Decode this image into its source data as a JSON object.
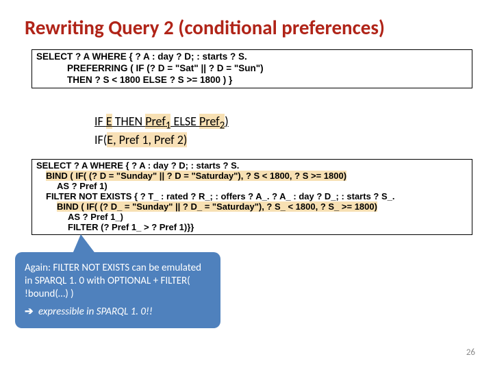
{
  "title": "Rewriting Query 2 (conditional preferences)",
  "box1": {
    "l1": "SELECT ? A WHERE { ? A : day  ? D;  : starts  ? S.",
    "l2": "            PREFERRING ( IF (? D = \"Sat\" || ? D = \"Sun\")",
    "l3": "            THEN  ? S < 1800 ELSE  ? S >= 1800 ) }"
  },
  "mid": {
    "row1_pre": "IF ",
    "row1_e": "E",
    "row1_mid": " THEN ",
    "row1_p1": "Pref",
    "row1_p1_sub": "1",
    "row1_else": " ELSE ",
    "row1_p2": "Pref",
    "row1_p2_sub": "2",
    "row1_end": ")",
    "row2_pre": "IF(",
    "row2_e": "E",
    "row2_mid": ", Pref 1",
    "row2_mid2": ", Pref 2)"
  },
  "box2": {
    "l1": "SELECT ? A WHERE { ? A : day  ? D;  : starts  ? S.",
    "l2a": "BIND ( IF( (? D = \"Sunday\" || ? D = \"Saturday\"),  ? S < 1800,  ? S >= 1800)",
    "l2b": "AS ? Pref 1)",
    "l3a": "FILTER NOT EXISTS {  ? T_ : rated  ? R_;  : offers  ? A_.  ? A_ : day  ? D_;  : starts  ? S_.",
    "l4a": "BIND ( IF( (? D_ = \"Sunday\" || ? D_ = \"Saturday\"),  ? S_ < 1800,  ? S_ >= 1800)",
    "l4b": "AS  ? Pref 1_)",
    "l4c": "FILTER (? Pref 1_ > ? Pref 1)}}"
  },
  "callout": {
    "p1": "Again: FILTER NOT EXISTS can be emulated in SPARQL 1. 0 with OPTIONAL + FILTER( !bound(…) )",
    "arrow": "➔",
    "p2": " expressible in SPARQL 1. 0!!"
  },
  "pagenum": "26"
}
